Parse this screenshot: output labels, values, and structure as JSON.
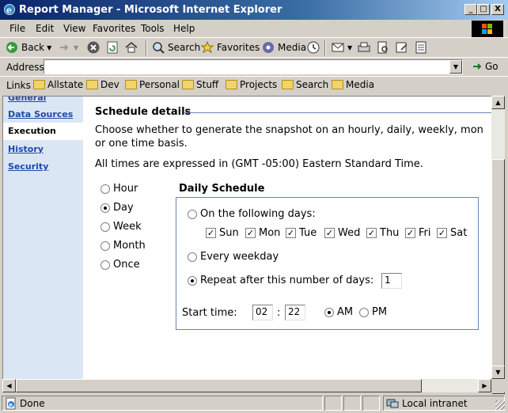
{
  "window": {
    "title": "Report Manager - Microsoft Internet Explorer",
    "minimize_glyph": "_",
    "maximize_glyph": "□",
    "close_glyph": "X"
  },
  "menu": {
    "file": "File",
    "edit": "Edit",
    "view": "View",
    "favorites": "Favorites",
    "tools": "Tools",
    "help": "Help"
  },
  "toolbar": {
    "back": "Back",
    "search": "Search",
    "favorites": "Favorites",
    "media": "Media"
  },
  "address": {
    "label": "Address",
    "value": "",
    "go": "Go"
  },
  "links": {
    "label": "Links",
    "items": [
      "Allstate",
      "Dev",
      "Personal",
      "Stuff",
      "Projects",
      "Search",
      "Media"
    ]
  },
  "sidebar": {
    "partial_item": "General",
    "data_sources": "Data Sources",
    "execution": "Execution",
    "history": "History",
    "security": "Security"
  },
  "main": {
    "section_title": "Schedule details",
    "desc_line1": "Choose whether to generate the snapshot on an hourly, daily, weekly, mon",
    "desc_line2": "or one time basis.",
    "timezone": "All times are expressed in (GMT -05:00) Eastern Standard Time.",
    "frequency": {
      "options": [
        "Hour",
        "Day",
        "Week",
        "Month",
        "Once"
      ],
      "selected": "Day"
    },
    "daily": {
      "title": "Daily Schedule",
      "following_days_label": "On the following days:",
      "days": [
        {
          "label": "Sun",
          "checked": true
        },
        {
          "label": "Mon",
          "checked": true
        },
        {
          "label": "Tue",
          "checked": true
        },
        {
          "label": "Wed",
          "checked": true
        },
        {
          "label": "Thu",
          "checked": true
        },
        {
          "label": "Fri",
          "checked": true
        },
        {
          "label": "Sat",
          "checked": true
        }
      ],
      "every_weekday_label": "Every weekday",
      "repeat_label": "Repeat after this number of days:",
      "repeat_value": "1",
      "selected_option": "repeat",
      "start_time_label": "Start time:",
      "hour": "02",
      "colon": ":",
      "minute": "22",
      "am": "AM",
      "pm": "PM",
      "ampm_selected": "AM"
    }
  },
  "status": {
    "text": "Done",
    "zone": "Local intranet"
  },
  "colors": {
    "title_gradient_start": "#0a246a",
    "sidebar_bg": "#dbe6f5",
    "link": "#1f48a8",
    "box_border": "#6b85b5"
  }
}
